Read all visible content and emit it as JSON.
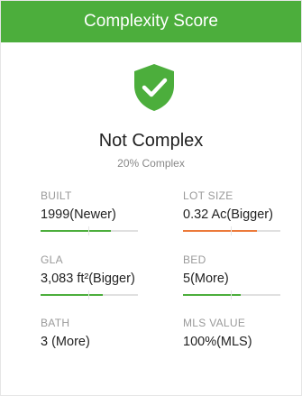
{
  "header": {
    "title": "Complexity Score"
  },
  "status": {
    "icon": "shield-check-icon",
    "title": "Not Complex",
    "subtitle": "20% Complex",
    "color": "#4cae3c"
  },
  "metrics": [
    {
      "label": "BUILT",
      "value": "1999(Newer)",
      "bar_fill": 0.72,
      "bar_color": "#4cae3c"
    },
    {
      "label": "LOT SIZE",
      "value": "0.32 Ac(Bigger)",
      "bar_fill": 0.76,
      "bar_color": "#ec7a3a"
    },
    {
      "label": "GLA",
      "value": "3,083 ft²(Bigger)",
      "bar_fill": 0.64,
      "bar_color": "#4cae3c"
    },
    {
      "label": "BED",
      "value": "5(More)",
      "bar_fill": 0.59,
      "bar_color": "#4cae3c"
    },
    {
      "label": "BATH",
      "value": "3 (More)"
    },
    {
      "label": "MLS VALUE",
      "value": "100%(MLS)"
    }
  ]
}
